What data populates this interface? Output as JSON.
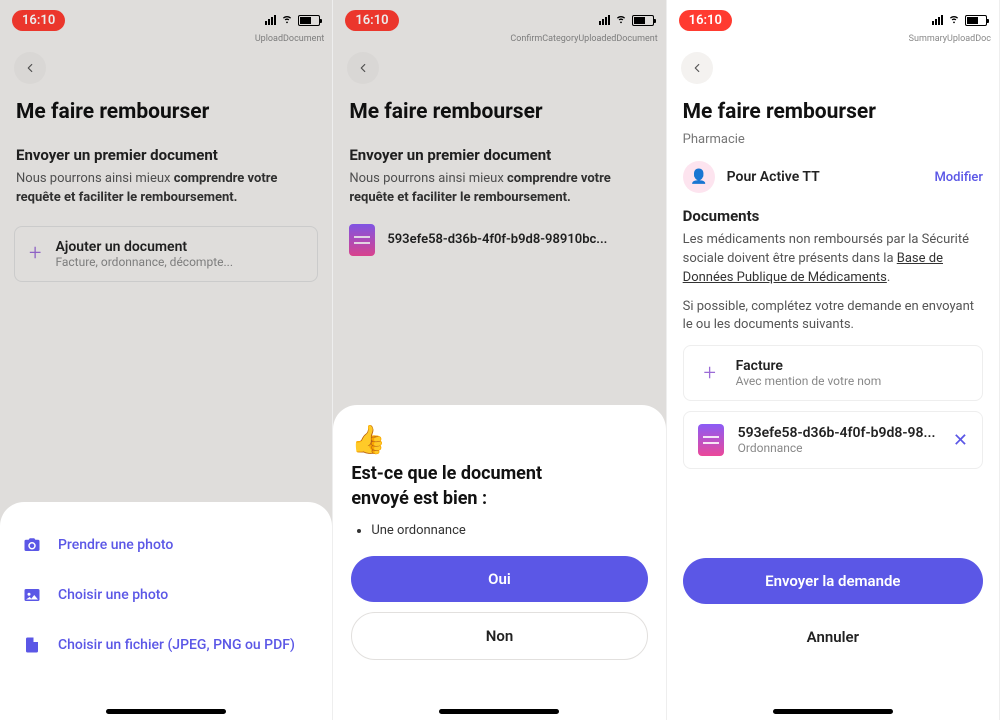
{
  "status": {
    "time": "16:10"
  },
  "screen1": {
    "name": "UploadDocument",
    "title": "Me faire rembourser",
    "section_title": "Envoyer un premier document",
    "desc_pre": "Nous pourrons ainsi mieux ",
    "desc_bold": "comprendre votre requête et faciliter le remboursement.",
    "add_doc_title": "Ajouter un document",
    "add_doc_sub": "Facture, ordonnance, décompte...",
    "sheet": {
      "opt1": "Prendre une photo",
      "opt2": "Choisir une photo",
      "opt3": "Choisir un fichier (JPEG, PNG ou PDF)"
    }
  },
  "screen2": {
    "name": "ConfirmCategoryUploadedDocument",
    "title": "Me faire rembourser",
    "section_title": "Envoyer un premier document",
    "desc_pre": "Nous pourrons ainsi mieux ",
    "desc_bold": "comprendre votre requête et faciliter le remboursement.",
    "file_name": "593efe58-d36b-4f0f-b9d8-98910bc...",
    "sheet": {
      "emoji": "👍",
      "question_l1": "Est-ce que le document",
      "question_l2": "envoyé est bien :",
      "bullet": "Une ordonnance",
      "yes": "Oui",
      "no": "Non"
    }
  },
  "screen3": {
    "name": "SummaryUploadDoc",
    "title": "Me faire rembourser",
    "category": "Pharmacie",
    "person_name": "Pour Active TT",
    "modify": "Modifier",
    "docs_title": "Documents",
    "info1_pre": "Les médicaments non remboursés par la Sécurité sociale doivent être présents dans la ",
    "info1_link": "Base de Données Publique de Médicaments",
    "info2": "Si possible, complétez votre demande en envoyant le ou les documents suivants.",
    "facture_title": "Facture",
    "facture_sub": "Avec mention de votre nom",
    "uploaded_name": "593efe58-d36b-4f0f-b9d8-98...",
    "uploaded_sub": "Ordonnance",
    "submit": "Envoyer la demande",
    "cancel": "Annuler"
  }
}
